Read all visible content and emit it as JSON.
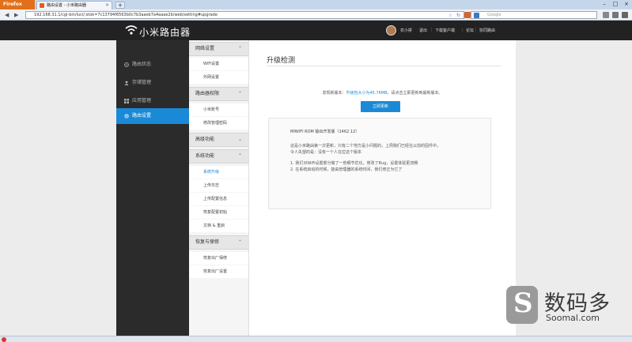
{
  "browser": {
    "menu_button": "Firefox",
    "tab_title": "路由设置 - 小米路由器",
    "url": "192.168.31.1/cgi-bin/luci/;stok=7c13794f6563b0c7b3aaeb7a4aaae2b/web/setting#upgrade",
    "search_placeholder": "Google",
    "new_tab": "+"
  },
  "header": {
    "brand": "小米路由器",
    "links": [
      "农小拼",
      "退出",
      "下载客户端",
      "论坛",
      "协同路由"
    ]
  },
  "sidebar": {
    "items": [
      {
        "label": "路由状态",
        "icon": "dashboard-icon"
      },
      {
        "label": "存储管理",
        "icon": "user-icon"
      },
      {
        "label": "应用管理",
        "icon": "apps-icon"
      },
      {
        "label": "路由设置",
        "icon": "gear-icon",
        "active": true
      }
    ]
  },
  "submenu": {
    "groups": [
      {
        "label": "网络设置",
        "items": [
          "WiFi设置",
          "外网设置"
        ]
      },
      {
        "label": "路由器权限",
        "items": [
          "小米账号",
          "修改管理密码"
        ]
      },
      {
        "label": "高级功能",
        "items": []
      },
      {
        "label": "系统功能",
        "items": [
          "系统升级",
          "上传日志",
          "上传配置信息",
          "恢复配置初始",
          "文档 & 重启"
        ]
      },
      {
        "label": "恢复与保修",
        "items": [
          "恢复出厂保修",
          "恢复出厂设置"
        ]
      }
    ],
    "active_item": "系统升级"
  },
  "main": {
    "title": "升级检测",
    "found_prefix": "发现新版本：",
    "found_version": "升级包大小为45.76MB",
    "found_suffix": "，请点击立即更新到最新版本。",
    "upgrade_button": "立即更新",
    "notes_title": "MIWIFI ROM 输出开发版（1462.12）",
    "notes_lines": [
      "这是小米路由第一次更新，只有二个地方是小问题的，上周我们已经在以前的固件中，",
      "令人失望的是：没有一个人在拉这个版本",
      "",
      "1. 我们对WiFi设置部分做了一些细节优化，修改了Bug，设置体验更流畅",
      "2. 在系统启动的时候，能由管理器的系统时间，我们修正为它了"
    ]
  },
  "watermark": {
    "cn": "数码多",
    "en": "Soomal.com"
  }
}
